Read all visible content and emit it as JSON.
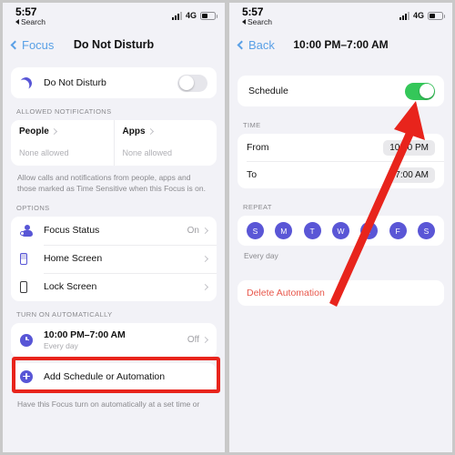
{
  "status_bar": {
    "time": "5:57",
    "back_label": "Search",
    "network": "4G"
  },
  "left_screen": {
    "nav": {
      "back_label": "Focus",
      "title": "Do Not Disturb"
    },
    "dnd_row": {
      "label": "Do Not Disturb",
      "icon": "moon-icon",
      "toggle_state": "off"
    },
    "allowed_notifications": {
      "header": "ALLOWED NOTIFICATIONS",
      "columns": [
        {
          "title": "People",
          "subtitle": "None allowed"
        },
        {
          "title": "Apps",
          "subtitle": "None allowed"
        }
      ],
      "footnote": "Allow calls and notifications from people, apps and those marked as Time Sensitive when this Focus is on."
    },
    "options": {
      "header": "OPTIONS",
      "items": [
        {
          "label": "Focus Status",
          "value": "On",
          "icon": "focus-status-icon"
        },
        {
          "label": "Home Screen",
          "value": "",
          "icon": "home-screen-icon"
        },
        {
          "label": "Lock Screen",
          "value": "",
          "icon": "lock-screen-icon"
        }
      ]
    },
    "turn_on_automatically": {
      "header": "TURN ON AUTOMATICALLY",
      "schedule": {
        "title": "10:00 PM–7:00 AM",
        "subtitle": "Every day",
        "value": "Off",
        "icon": "clock-icon"
      },
      "add_item": {
        "label": "Add Schedule or Automation",
        "icon": "plus-circle-icon"
      },
      "footnote": "Have this Focus turn on automatically at a set time or"
    }
  },
  "right_screen": {
    "nav": {
      "back_label": "Back",
      "title": "10:00 PM–7:00 AM"
    },
    "schedule_row": {
      "label": "Schedule",
      "toggle_state": "on"
    },
    "time": {
      "header": "TIME",
      "rows": [
        {
          "label": "From",
          "value": "10:00 PM"
        },
        {
          "label": "To",
          "value": "7:00 AM"
        }
      ]
    },
    "repeat": {
      "header": "REPEAT",
      "days": [
        "S",
        "M",
        "T",
        "W",
        "T",
        "F",
        "S"
      ],
      "summary": "Every day"
    },
    "delete": {
      "label": "Delete Automation"
    }
  },
  "annotations": {
    "highlight_color": "#e8241c",
    "arrow_color": "#e8241c"
  },
  "colors": {
    "accent_purple": "#5856d6",
    "toggle_on_green": "#34c759",
    "link_blue": "#5aa0e6",
    "destructive_red": "#e8584c"
  }
}
